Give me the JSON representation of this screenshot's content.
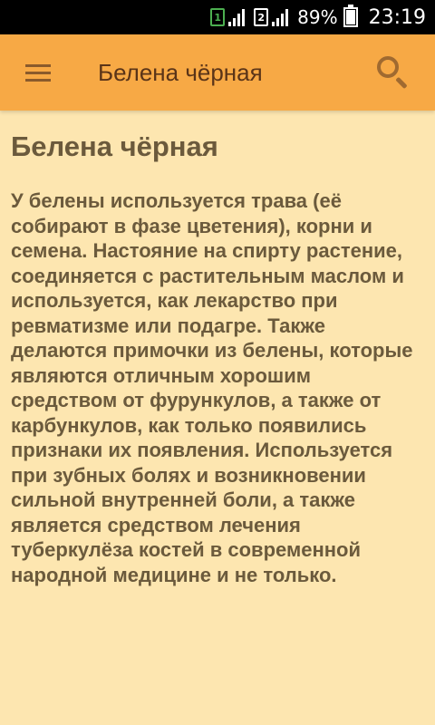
{
  "status_bar": {
    "sim1": "1",
    "sim2": "2",
    "battery_percent": "89%",
    "battery_level": 0.89,
    "time": "23:19"
  },
  "app_bar": {
    "title": "Белена чёрная",
    "menu_icon": "hamburger-menu-icon",
    "search_icon": "search-icon"
  },
  "content": {
    "heading": "Белена чёрная",
    "body": "У белены используется трава (её собирают в фазе цветения), корни и семена. Настояние на спирту растение, соединяется с растительным маслом и используется, как лекарство при ревматизме или подагре. Также делаются примочки из белены, которые являются отличным хорошим средством от фурункулов, а также от карбункулов, как только появились признаки их появления. Используется при зубных болях и возникновении сильной внутренней боли, а также является средством лечения туберкулёза костей в современной народной медицине и не только."
  },
  "colors": {
    "app_bar": "#f7a945",
    "background": "#fde6b0",
    "text": "#6b5a3c"
  }
}
